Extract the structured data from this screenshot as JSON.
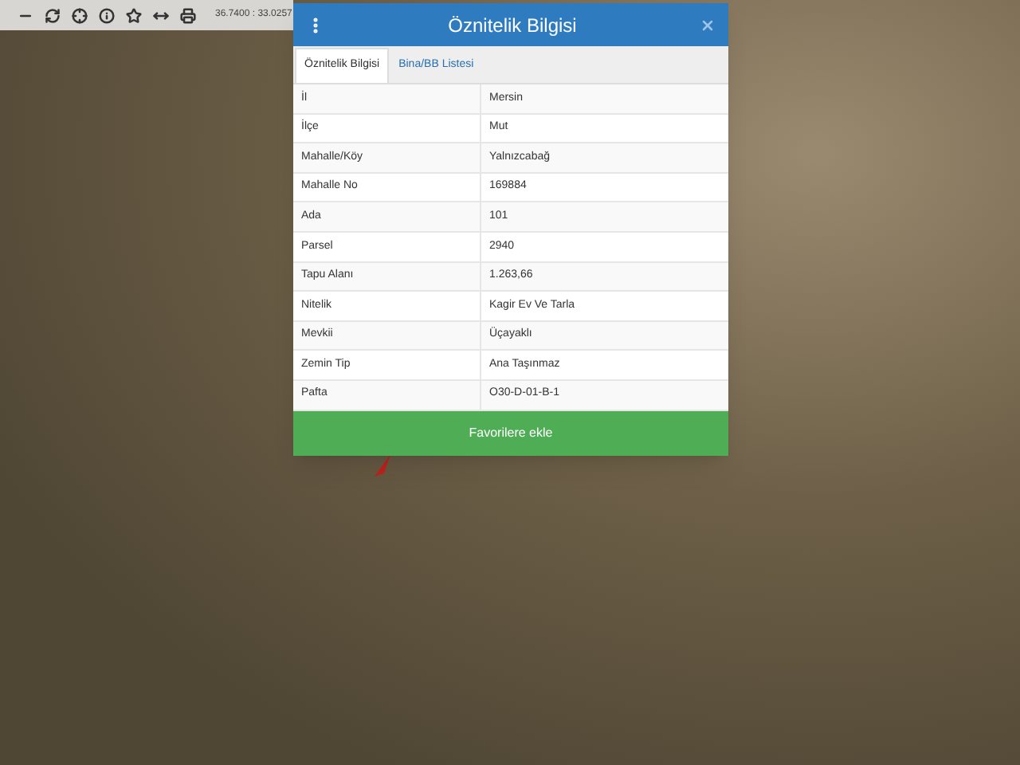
{
  "toolbar": {
    "coordinates": "36.7400 : 33.0257"
  },
  "dialog": {
    "title": "Öznitelik Bilgisi",
    "tabs": [
      {
        "label": "Öznitelik Bilgisi",
        "selected": true
      },
      {
        "label": "Bina/BB Listesi",
        "selected": false
      }
    ],
    "rows": [
      {
        "label": "İl",
        "value": "Mersin"
      },
      {
        "label": "İlçe",
        "value": "Mut"
      },
      {
        "label": "Mahalle/Köy",
        "value": "Yalnızcabağ"
      },
      {
        "label": "Mahalle No",
        "value": "169884"
      },
      {
        "label": "Ada",
        "value": "101"
      },
      {
        "label": "Parsel",
        "value": "2940"
      },
      {
        "label": "Tapu Alanı",
        "value": "1.263,66"
      },
      {
        "label": "Nitelik",
        "value": "Kagir Ev Ve Tarla"
      },
      {
        "label": "Mevkii",
        "value": "Üçayaklı"
      },
      {
        "label": "Zemin Tip",
        "value": "Ana Taşınmaz"
      },
      {
        "label": "Pafta",
        "value": "O30-D-01-B-1"
      }
    ],
    "button": "Favorilere ekle"
  }
}
